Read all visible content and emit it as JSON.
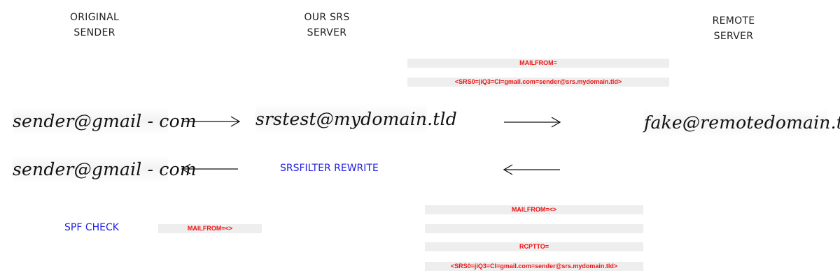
{
  "headers": {
    "original_sender": [
      "ORIGINAL",
      "SENDER"
    ],
    "our_srs_server": [
      "OUR SRS",
      "SERVER"
    ],
    "remote_server": [
      "REMOTE",
      "SERVER"
    ]
  },
  "addresses": {
    "sender_forward": "sender@gmail - com",
    "srs_server": "srstest@mydomain.tld",
    "remote": "fake@remotedomain.tld",
    "sender_return": "sender@gmail - com"
  },
  "labels": {
    "srsfilter_rewrite": "SRSFILTER REWRITE",
    "spf_check": "SPF CHECK"
  },
  "forward_envelope": {
    "mailfrom": "MAILFROM=",
    "mailfrom_value": "<SRS0=jiQ3=CI=gmail.com=sender@srs.mydomain.tld>"
  },
  "return_envelope": {
    "mailfrom": "MAILFROM=<>",
    "rcptto": "RCPTTO=",
    "rcptto_value": "<SRS0=jiQ3=CI=gmail.com=sender@srs.mydomain.tld>"
  },
  "spf_mailfrom": "MAILFROM=<>",
  "colors": {
    "label_blue": "#1f1fe0",
    "envelope_red": "#ee1111",
    "band_gray": "#eeeeee"
  }
}
